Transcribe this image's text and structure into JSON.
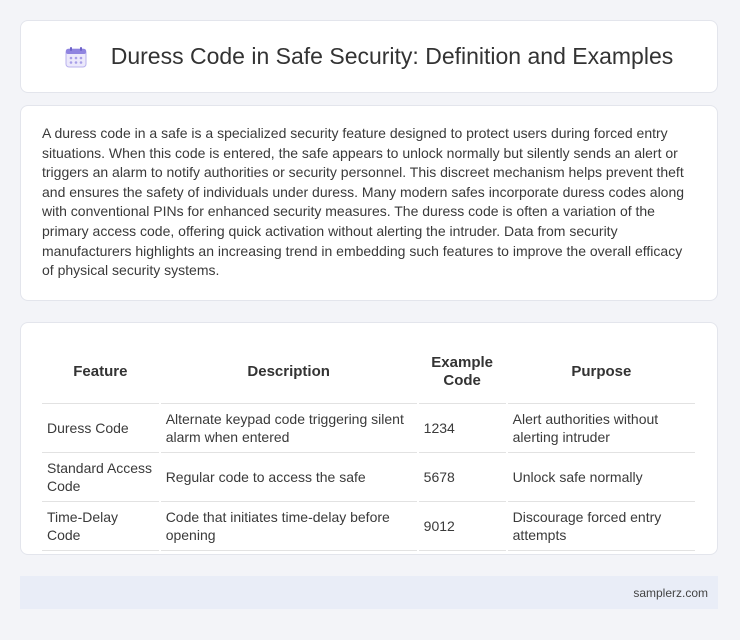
{
  "header": {
    "title": "Duress Code in Safe Security: Definition and Examples",
    "icon": "calendar-icon",
    "accent": "#7c6fd6"
  },
  "intro": {
    "text": "A duress code in a safe is a specialized security feature designed to protect users during forced entry situations. When this code is entered, the safe appears to unlock normally but silently sends an alert or triggers an alarm to notify authorities or security personnel. This discreet mechanism helps prevent theft and ensures the safety of individuals under duress. Many modern safes incorporate duress codes along with conventional PINs for enhanced security measures. The duress code is often a variation of the primary access code, offering quick activation without alerting the intruder. Data from security manufacturers highlights an increasing trend in embedding such features to improve the overall efficacy of physical security systems."
  },
  "table": {
    "headers": [
      "Feature",
      "Description",
      "Example Code",
      "Purpose"
    ],
    "rows": [
      [
        "Duress Code",
        "Alternate keypad code triggering silent alarm when entered",
        "1234",
        "Alert authorities without alerting intruder"
      ],
      [
        "Standard Access Code",
        "Regular code to access the safe",
        "5678",
        "Unlock safe normally"
      ],
      [
        "Time-Delay Code",
        "Code that initiates time-delay before opening",
        "9012",
        "Discourage forced entry attempts"
      ]
    ]
  },
  "footer": {
    "text": "samplerz.com"
  }
}
